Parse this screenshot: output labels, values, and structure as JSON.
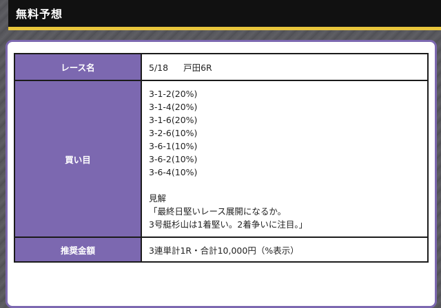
{
  "header": {
    "title": "無料予想"
  },
  "colors": {
    "accent_purple": "#7c68b0",
    "header_bg": "#111111",
    "header_underline": "#e9c63c"
  },
  "table": {
    "race": {
      "label": "レース名",
      "date": "5/18",
      "name": "戸田6R"
    },
    "bets": {
      "label": "買い目",
      "lines": [
        "3-1-2(20%)",
        "3-1-4(20%)",
        "3-1-6(20%)",
        "3-2-6(10%)",
        "3-6-1(10%)",
        "3-6-2(10%)",
        "3-6-4(10%)"
      ],
      "opinion_label": "見解",
      "opinion_lines": [
        "「最終日堅いレース展開になるか。",
        "3号艇杉山は1着堅い。2着争いに注目。」"
      ]
    },
    "amount": {
      "label": "推奨金額",
      "value": "3連単計1R・合計10,000円（%表示）"
    }
  }
}
